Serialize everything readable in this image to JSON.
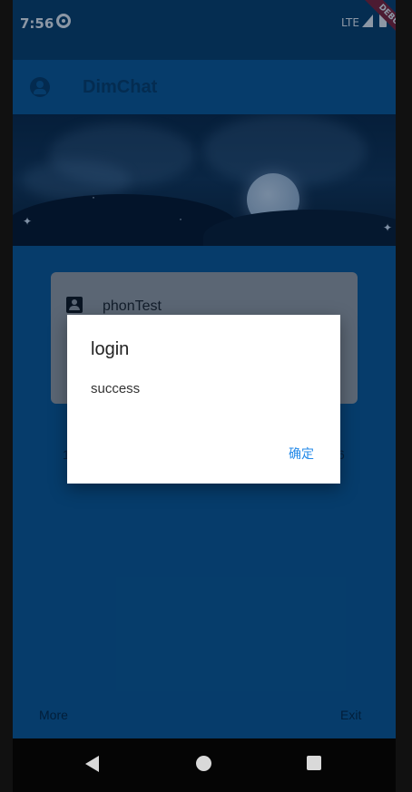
{
  "status": {
    "time": "7:56",
    "network": "LTE",
    "debug_label": "DEBUG"
  },
  "app_bar": {
    "title": "DimChat"
  },
  "login_card": {
    "username": "phonTest"
  },
  "background_fragments": {
    "left": "1",
    "right": "6"
  },
  "bottom": {
    "more_label": "More",
    "exit_label": "Exit"
  },
  "dialog": {
    "title": "login",
    "message": "success",
    "confirm_label": "确定"
  },
  "colors": {
    "primary": "#0b5a95",
    "status_bar": "#0a3f66",
    "dialog_button": "#2389e8"
  },
  "icons": [
    "sync-icon",
    "signal-icon",
    "battery-icon",
    "account-icon",
    "user-icon",
    "back-icon",
    "home-icon",
    "recent-apps-icon"
  ]
}
